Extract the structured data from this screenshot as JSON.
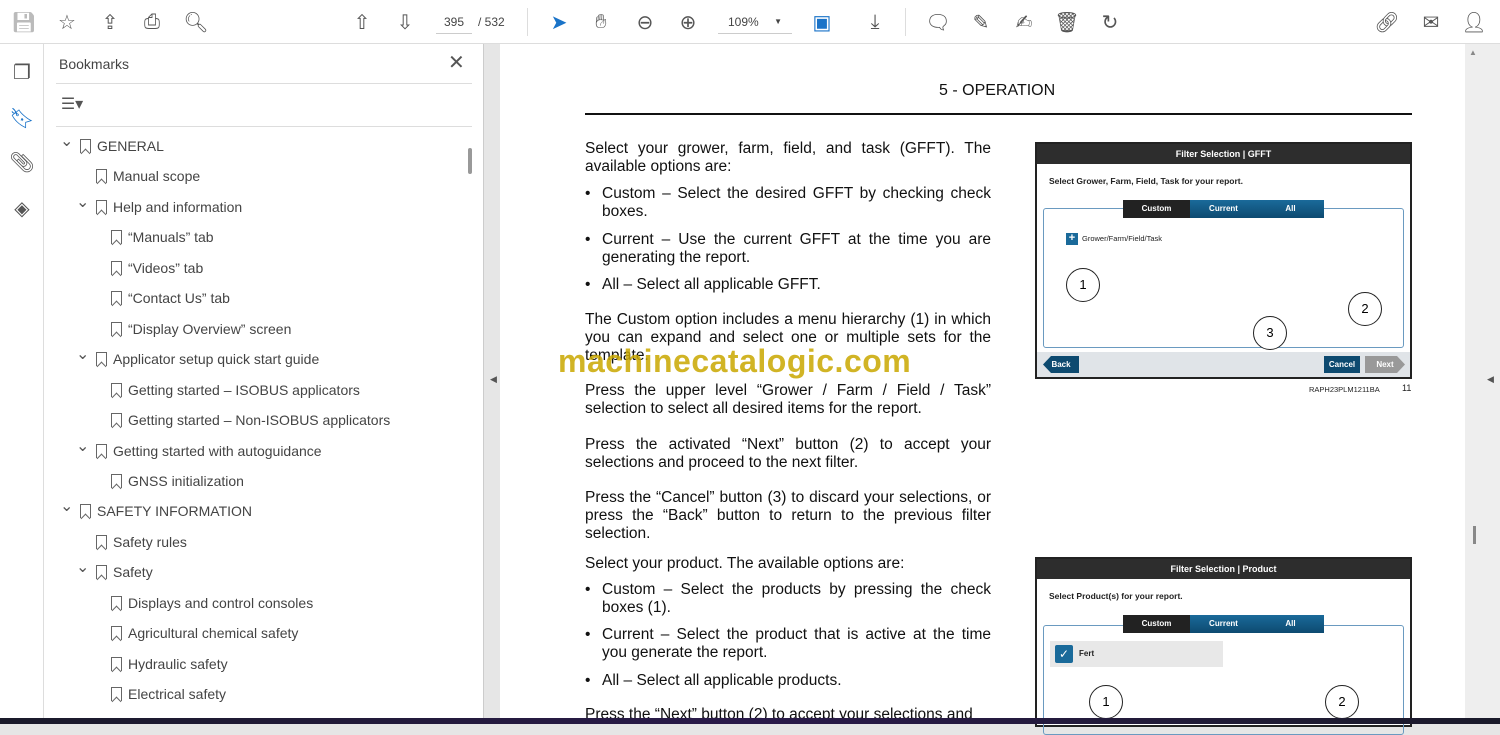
{
  "toolbar": {
    "page_current": "395",
    "page_total": "/ 532",
    "zoom": "109%"
  },
  "bookmarks": {
    "title": "Bookmarks",
    "items": [
      {
        "label": "GENERAL",
        "level": 0,
        "expandable": true
      },
      {
        "label": "Manual scope",
        "level": 1,
        "expandable": false
      },
      {
        "label": "Help and information",
        "level": 1,
        "expandable": true
      },
      {
        "label": "“Manuals” tab",
        "level": 2,
        "expandable": false
      },
      {
        "label": "“Videos” tab",
        "level": 2,
        "expandable": false
      },
      {
        "label": "“Contact Us” tab",
        "level": 2,
        "expandable": false
      },
      {
        "label": "“Display Overview” screen",
        "level": 2,
        "expandable": false
      },
      {
        "label": "Applicator setup quick start guide",
        "level": 1,
        "expandable": true
      },
      {
        "label": "Getting started – ISOBUS applicators",
        "level": 2,
        "expandable": false
      },
      {
        "label": "Getting started – Non-ISOBUS applicators",
        "level": 2,
        "expandable": false
      },
      {
        "label": "Getting started with autoguidance",
        "level": 1,
        "expandable": true
      },
      {
        "label": "GNSS initialization",
        "level": 2,
        "expandable": false
      },
      {
        "label": "SAFETY INFORMATION",
        "level": 0,
        "expandable": true
      },
      {
        "label": "Safety rules",
        "level": 1,
        "expandable": false
      },
      {
        "label": "Safety",
        "level": 1,
        "expandable": true
      },
      {
        "label": "Displays and control consoles",
        "level": 2,
        "expandable": false
      },
      {
        "label": "Agricultural chemical safety",
        "level": 2,
        "expandable": false
      },
      {
        "label": "Hydraulic safety",
        "level": 2,
        "expandable": false
      },
      {
        "label": "Electrical safety",
        "level": 2,
        "expandable": false
      }
    ]
  },
  "doc": {
    "header": "5 - OPERATION",
    "p1": "Select your grower, farm, field, and task (GFFT). The available options are:",
    "b1": [
      "Custom – Select the desired GFFT by checking check boxes.",
      "Current – Use the current GFFT at the time you are generating the report.",
      "All – Select all applicable GFFT."
    ],
    "p2": "The Custom option includes a menu hierarchy (1) in which you can expand and select one or multiple sets for the template.",
    "p3": "Press the upper level “Grower / Farm / Field / Task” selection to select all desired items for the report.",
    "p4": "Press the activated “Next” button (2) to accept your selections and proceed to the next filter.",
    "p5": "Press the “Cancel” button (3) to discard your selections, or press the “Back” button to return to the previous filter selection.",
    "p6": "Select your product. The available options are:",
    "b2": [
      "Custom – Select the products by pressing the check boxes (1).",
      "Current – Select the product that is active at the time you generate the report.",
      "All – Select all applicable products."
    ],
    "p7": "Press the “Next” button (2) to accept your selections and",
    "watermark": "machinecatalogic.com",
    "fig1": {
      "title": "Filter Selection | GFFT",
      "subtitle": "Select Grower, Farm, Field, Task for your report.",
      "tabs": [
        "Custom",
        "Current",
        "All"
      ],
      "item": "Grower/Farm/Field/Task",
      "back": "Back",
      "cancel": "Cancel",
      "next": "Next",
      "callouts": [
        "1",
        "2",
        "3"
      ],
      "code": "RAPH23PLM1211BA",
      "num": "11"
    },
    "fig2": {
      "title": "Filter Selection | Product",
      "subtitle": "Select Product(s) for your report.",
      "tabs": [
        "Custom",
        "Current",
        "All"
      ],
      "item": "Fert",
      "callouts": [
        "1",
        "2"
      ]
    }
  }
}
